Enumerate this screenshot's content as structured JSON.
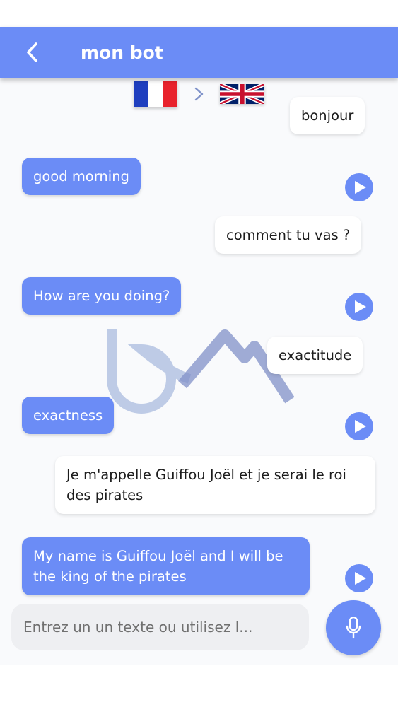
{
  "header": {
    "title": "mon bot",
    "back_icon": "chevron-left-icon",
    "background_color": "#6b8cf6"
  },
  "language_pair": {
    "source_flag": "france-flag",
    "target_flag": "uk-flag",
    "separator_icon": "chevron-right-icon"
  },
  "messages": [
    {
      "role": "user",
      "text": "bonjour"
    },
    {
      "role": "bot",
      "text": "good morning",
      "play_icon": "play-icon"
    },
    {
      "role": "user",
      "text": "comment tu vas ?"
    },
    {
      "role": "bot",
      "text": "How are you doing?",
      "play_icon": "play-icon"
    },
    {
      "role": "user",
      "text": "exactitude"
    },
    {
      "role": "bot",
      "text": "exactness",
      "play_icon": "play-icon"
    },
    {
      "role": "user",
      "text": "Je m'appelle Guiffou Joël et je serai le roi des pirates"
    },
    {
      "role": "bot",
      "text": "My name is Guiffou Joël and I will be the king of the pirates",
      "play_icon": "play-icon"
    }
  ],
  "composer": {
    "placeholder": "Entrez un un texte ou utilisez l...",
    "mic_icon": "microphone-icon"
  },
  "colors": {
    "accent": "#6b8cf6",
    "user_bubble": "#ffffff",
    "bot_bubble": "#6b8cf6"
  }
}
